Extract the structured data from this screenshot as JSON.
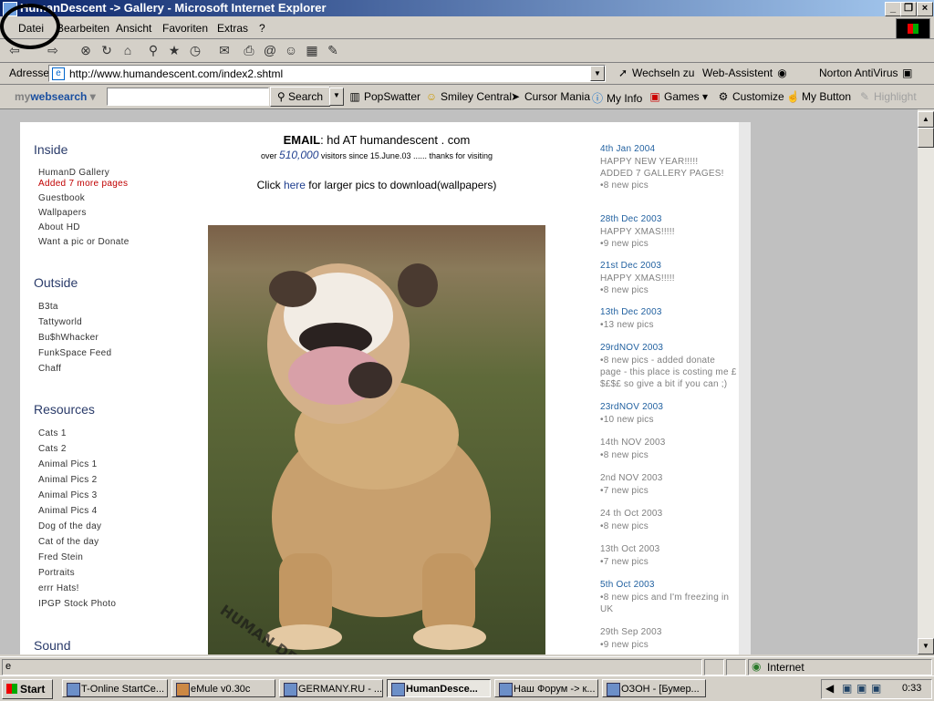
{
  "window": {
    "title": "HumanDescent -> Gallery - Microsoft Internet Explorer"
  },
  "menu": [
    "Datei",
    "Bearbeiten",
    "Ansicht",
    "Favoriten",
    "Extras",
    "?"
  ],
  "address": {
    "label": "Adresse",
    "url": "http://www.humandescent.com/index2.shtml",
    "go": "Wechseln zu",
    "links": [
      "Web-Assistent",
      "Norton AntiVirus"
    ]
  },
  "links_bar": {
    "mywebsearch_my": "my",
    "mywebsearch_web": "websearch",
    "search_label": "Search",
    "items": [
      "PopSwatter",
      "Smiley Central",
      "Cursor Mania",
      "My Info",
      "Games",
      "Customize",
      "My Button",
      "Highlight"
    ]
  },
  "page": {
    "email_label": "EMAIL",
    "email_text": ": hd AT humandescent . com",
    "visitors_pre": "over ",
    "visitors_count": "510,000",
    "visitors_post": " visitors since 15.June.03 ...... thanks for visiting",
    "click_pre": "Click ",
    "click_link": "here",
    "click_post": " for larger pics to download(wallpapers)",
    "photo_watermark": "HUMAN DESCENT",
    "sections": [
      {
        "title": "Inside",
        "links": [
          "HumanD Gallery",
          "Added 7 more pages",
          "Guestbook",
          "Wallpapers",
          "About HD",
          "Want a pic or Donate"
        ]
      },
      {
        "title": "Outside",
        "links": [
          "B3ta",
          "Tattyworld",
          "Bu$hWhacker",
          "FunkSpace Feed",
          "Chaff"
        ]
      },
      {
        "title": "Resources",
        "links": [
          "Cats 1",
          "Cats 2",
          "Animal Pics 1",
          "Animal Pics 2",
          "Animal Pics 3",
          "Animal Pics 4",
          "Dog of the day",
          "Cat of the day",
          "Fred Stein",
          "Portraits",
          "errr Hats!",
          "IPGP Stock Photo"
        ]
      },
      {
        "title": "Sound",
        "links": []
      }
    ],
    "news": [
      {
        "date": "4th Jan 2004",
        "lines": [
          "HAPPY NEW YEAR!!!!!",
          "ADDED 7 GALLERY PAGES!",
          "•8 new pics"
        ]
      },
      {
        "date": "28th Dec 2003",
        "lines": [
          "HAPPY XMAS!!!!!",
          "•9 new pics"
        ]
      },
      {
        "date": "21st Dec 2003",
        "lines": [
          "HAPPY XMAS!!!!!",
          "•8 new pics"
        ]
      },
      {
        "date": "13th Dec 2003",
        "lines": [
          "•13 new pics"
        ]
      },
      {
        "date": "29rdNOV 2003",
        "lines": [
          "•8 new pics - added donate page - this place is costing me £$£$£ so give a bit if you can ;)"
        ]
      },
      {
        "date": "23rdNOV 2003",
        "lines": [
          "•10 new pics"
        ]
      },
      {
        "date": "14th NOV 2003",
        "lines": [
          "•8 new pics"
        ]
      },
      {
        "date": "2nd NOV 2003",
        "lines": [
          "•7 new pics"
        ]
      },
      {
        "date": "24 th Oct 2003",
        "lines": [
          "•8 new pics"
        ]
      },
      {
        "date": "13th Oct 2003",
        "lines": [
          "•7 new pics"
        ]
      },
      {
        "date": "5th Oct 2003",
        "lines": [
          "•8 new pics and I'm freezing in UK"
        ]
      },
      {
        "date": "29th Sep 2003",
        "lines": [
          "•9 new pics"
        ]
      }
    ]
  },
  "status": {
    "zone": "Internet"
  },
  "taskbar": {
    "start": "Start",
    "tasks": [
      "T-Online StartCe...",
      "eMule v0.30c",
      "GERMANY.RU - ...",
      "HumanDesce...",
      "Наш Форум -> к...",
      "ОЗОН - [Бумер..."
    ],
    "clock": "0:33"
  },
  "colors": {
    "accent": "#0a246a",
    "link_red": "#c00000",
    "news_blue": "#1f5f9f"
  }
}
